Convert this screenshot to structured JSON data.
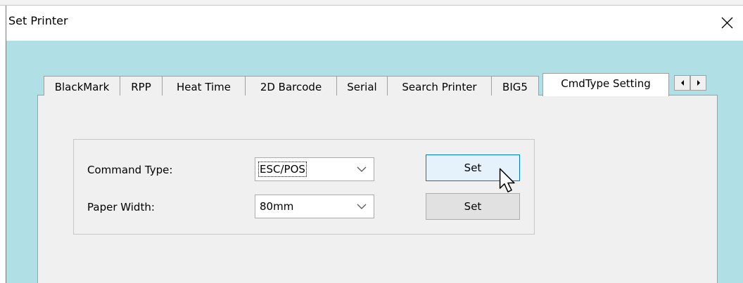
{
  "window": {
    "title": "Set Printer"
  },
  "tabs": [
    {
      "label": "BlackMark"
    },
    {
      "label": "RPP"
    },
    {
      "label": "Heat Time"
    },
    {
      "label": "2D Barcode"
    },
    {
      "label": "Serial"
    },
    {
      "label": "Search Printer"
    },
    {
      "label": "BIG5"
    },
    {
      "label": "CmdType Setting"
    }
  ],
  "active_tab": "CmdType Setting",
  "form": {
    "command_type_label": "Command Type:",
    "command_type_value": "ESC/POS",
    "paper_width_label": "Paper Width:",
    "paper_width_value": "80mm",
    "set_button_1": "Set",
    "set_button_2": "Set"
  },
  "icons": {
    "close": "close-icon",
    "tab_scroll_left": "arrow-left-icon",
    "tab_scroll_right": "arrow-right-icon",
    "dropdown": "chevron-down-icon",
    "cursor": "mouse-pointer-icon"
  },
  "colors": {
    "client_background": "#b0e0e6",
    "panel_background": "#f0f0f0",
    "hover_button_border": "#0078d7",
    "hover_button_background": "#e5f1fb"
  }
}
